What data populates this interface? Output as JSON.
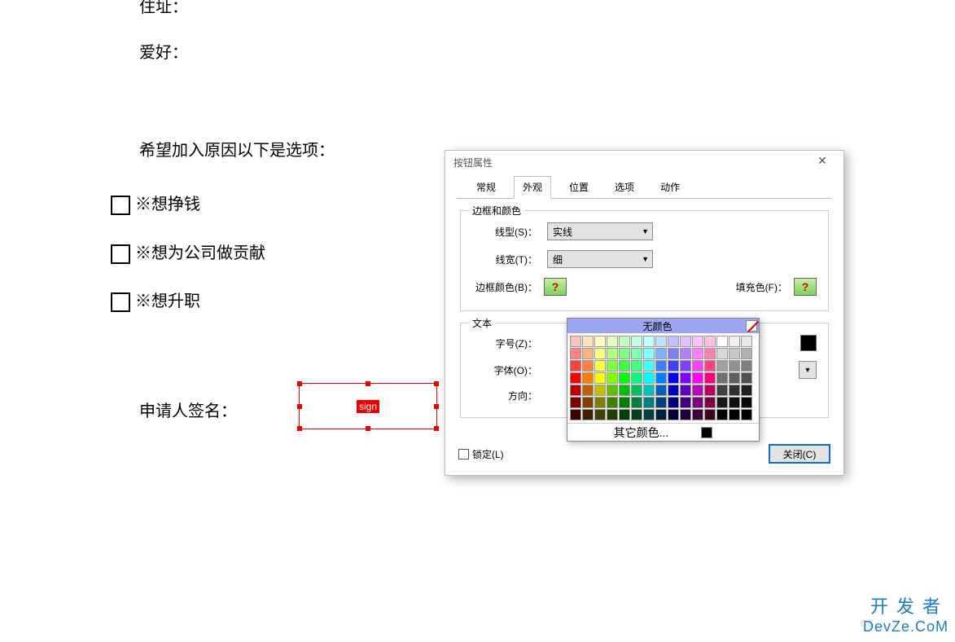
{
  "document": {
    "line0": "住址：",
    "line1": "爱好：",
    "line2": "希望加入原因以下是选项：",
    "opt1": "※想挣钱",
    "opt2": "※想为公司做贡献",
    "opt3": "※想升职",
    "signature_label": "申请人签名：",
    "sign_field_text": "sign"
  },
  "dialog": {
    "title": "按钮属性",
    "tabs": [
      "常规",
      "外观",
      "位置",
      "选项",
      "动作"
    ],
    "active_tab": 1,
    "fieldset1": {
      "legend": "边框和颜色",
      "line_style": {
        "label": "线型(S)：",
        "value": "实线"
      },
      "line_width": {
        "label": "线宽(T)：",
        "value": "细"
      },
      "border_color_label": "边框颜色(B)：",
      "fill_color_label": "填充色(F)："
    },
    "fieldset2": {
      "legend": "文本",
      "font_size_label": "字号(Z)：",
      "font_label": "字体(O)：",
      "direction_label": "方向："
    },
    "lock_label": "锁定(L)",
    "close_label": "关闭(C)"
  },
  "color_picker": {
    "no_color_label": "无颜色",
    "other_label": "其它颜色...",
    "rows": [
      [
        "#ffc0c0",
        "#ffe0c0",
        "#ffffc0",
        "#e0ffc0",
        "#c0ffc0",
        "#c0ffe0",
        "#c0ffff",
        "#c0e0ff",
        "#c0c0ff",
        "#e0c0ff",
        "#ffc0ff",
        "#ffc0e0",
        "#ffffff",
        "#f0f0f0",
        "#e8e8e8"
      ],
      [
        "#ff8080",
        "#ffb080",
        "#ffff80",
        "#b0ff80",
        "#80ff80",
        "#80ffb0",
        "#80ffff",
        "#80b0ff",
        "#8080ff",
        "#b080ff",
        "#ff80ff",
        "#ff80b0",
        "#d8d8d8",
        "#c8c8c8",
        "#b0b0b0"
      ],
      [
        "#ff4040",
        "#ff8040",
        "#ffff40",
        "#80ff40",
        "#40ff40",
        "#40ff80",
        "#40ffff",
        "#4080ff",
        "#4040ff",
        "#8040ff",
        "#ff40ff",
        "#ff4080",
        "#a0a0a0",
        "#909090",
        "#808080"
      ],
      [
        "#ff0000",
        "#ff8000",
        "#ffff00",
        "#80ff00",
        "#00ff00",
        "#00ff80",
        "#00ffff",
        "#0080ff",
        "#0000ff",
        "#8000ff",
        "#ff00ff",
        "#ff0080",
        "#707070",
        "#606060",
        "#505050"
      ],
      [
        "#c00000",
        "#c06000",
        "#c0c000",
        "#60c000",
        "#00c000",
        "#00c060",
        "#00c0c0",
        "#0060c0",
        "#0000c0",
        "#6000c0",
        "#c000c0",
        "#c00060",
        "#404040",
        "#303030",
        "#202020"
      ],
      [
        "#800000",
        "#804000",
        "#808000",
        "#408000",
        "#008000",
        "#008040",
        "#008080",
        "#004080",
        "#000080",
        "#400080",
        "#800080",
        "#800040",
        "#181818",
        "#101010",
        "#080808"
      ],
      [
        "#400000",
        "#402000",
        "#404000",
        "#204000",
        "#004000",
        "#004020",
        "#004040",
        "#002040",
        "#000040",
        "#200040",
        "#400040",
        "#400020",
        "#000000",
        "#000000",
        "#000000"
      ]
    ]
  },
  "watermark": {
    "faint": "cs",
    "line1": "开发者",
    "line2": "DevZe.CoM"
  }
}
